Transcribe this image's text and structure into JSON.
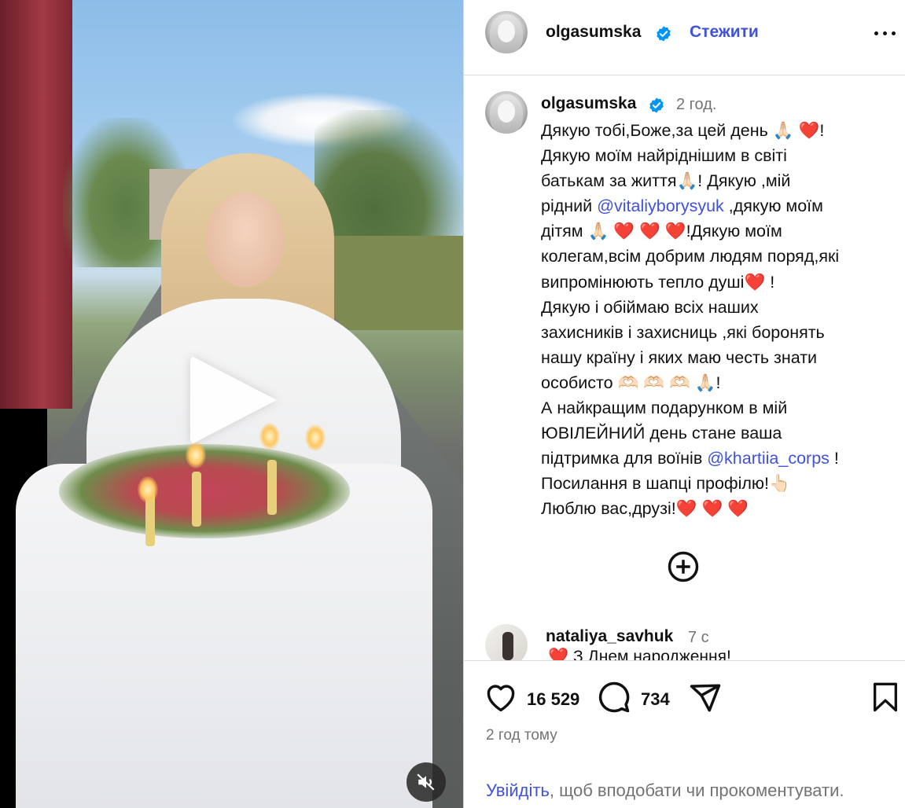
{
  "post": {
    "username": "olgasumska",
    "follow_label": "Стежити",
    "caption_time": "2 год.",
    "caption_lines": [
      [
        "Дякую тобі,Боже,за цей день ",
        "🙏🏻 ❤️",
        "!"
      ],
      [
        "Дякую моїм найріднішим в світі"
      ],
      [
        "батькам за життя",
        "🙏🏻",
        "! Дякую ,мій"
      ],
      [
        "рідний ",
        "@vitaliyborysyuk",
        " ,дякую моїм"
      ],
      [
        "дітям ",
        "🙏🏻 ❤️ ❤️ ❤️",
        "!Дякую  моїм"
      ],
      [
        "колегам,всім добрим людям поряд,які"
      ],
      [
        "випромінюють тепло душі",
        "❤️",
        " !"
      ],
      [
        "Дякую і обіймаю всіх наших"
      ],
      [
        "захисників і захисниць ,які боронять"
      ],
      [
        "нашу країну і яких маю честь знати"
      ],
      [
        "особисто ",
        "🫶🏻 🫶🏻 🫶🏻 🙏🏻",
        "!"
      ],
      [
        "А найкращим подарунком в мій"
      ],
      [
        "ЮВІЛЕЙНИЙ день стане ваша"
      ],
      [
        "підтримка для воїнів ",
        "@khartiia_corps",
        " !"
      ],
      [
        "Посилання в шапці профілю!",
        "👆🏻"
      ],
      [
        "Люблю вас,друзі!",
        "❤️ ❤️ ❤️"
      ]
    ],
    "mentions": [
      "@vitaliyborysyuk",
      "@khartiia_corps"
    ]
  },
  "comment": {
    "username": "nataliya_savhuk",
    "time": "7 с",
    "text": "❤️ З Днем народження!"
  },
  "actions": {
    "likes": "16 529",
    "comments": "734",
    "posted_ago": "2 год тому"
  },
  "login": {
    "link": "Увійдіть",
    "rest": ", щоб вподобати чи прокоментувати."
  },
  "colors": {
    "link": "#4052d6",
    "muted": "#737373",
    "verified": "#0095f6",
    "border": "#dbdbdb"
  },
  "icons": [
    "play-icon",
    "mute-icon",
    "verified-icon",
    "more-icon",
    "add-comment-icon",
    "heart-icon",
    "comment-icon",
    "share-icon",
    "bookmark-icon"
  ]
}
